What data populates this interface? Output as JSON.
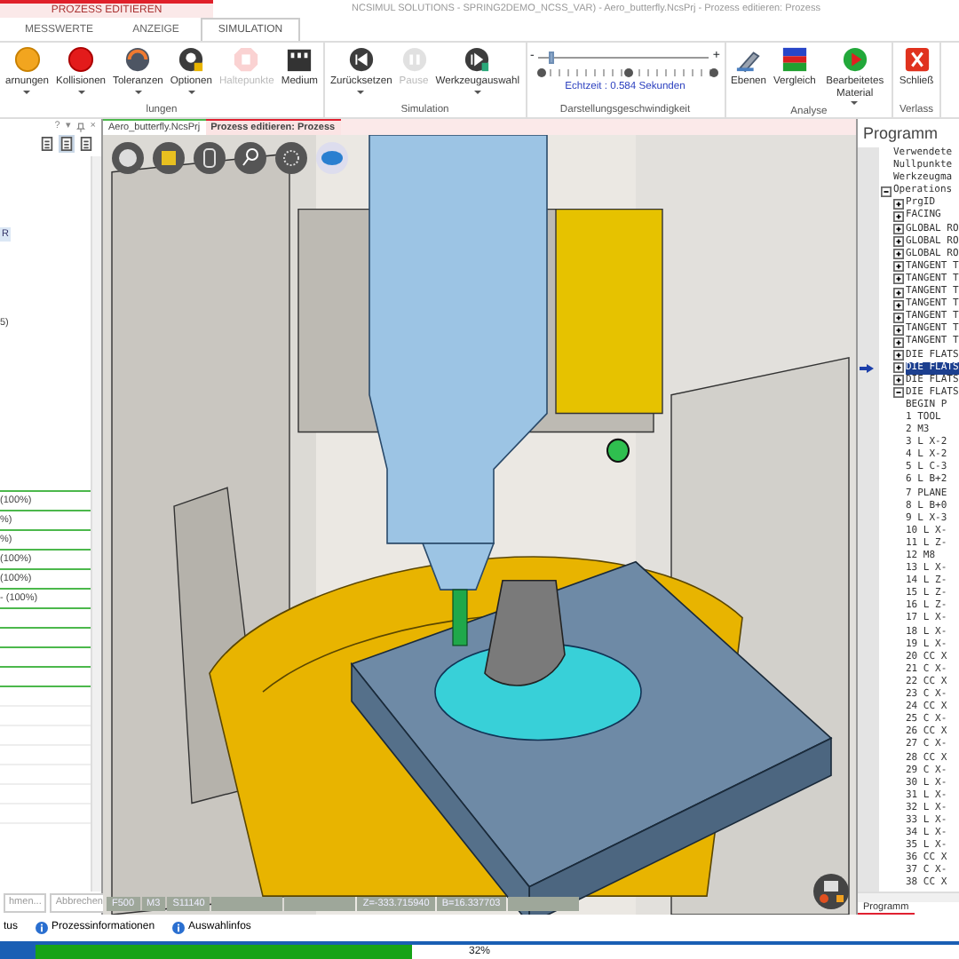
{
  "title_bar": {
    "context_tab": "PROZESS EDITIEREN",
    "title": "NCSIMUL SOLUTIONS - SPRING2DEMO_NCSS_VAR) - Aero_butterfly.NcsPrj - Prozess editieren: Prozess"
  },
  "ribbon_tabs": [
    {
      "label": "MESSWERTE",
      "selected": false
    },
    {
      "label": "ANZEIGE",
      "selected": false
    },
    {
      "label": "SIMULATION",
      "selected": true
    }
  ],
  "ribbon_groups": [
    {
      "label": "lungen",
      "kind": "buttons",
      "buttons": [
        {
          "label": "arnungen",
          "kind": "warning",
          "dropdown": true,
          "disabled": false
        },
        {
          "label": "Kollisionen",
          "kind": "collision",
          "dropdown": true,
          "disabled": false
        },
        {
          "label": "Toleranzen",
          "kind": "tolerance",
          "dropdown": true,
          "disabled": false
        },
        {
          "label": "Optionen",
          "kind": "options",
          "dropdown": true,
          "disabled": false
        },
        {
          "label": "Haltepunkte",
          "kind": "breakpoint",
          "dropdown": false,
          "disabled": true
        },
        {
          "label": "Medium",
          "kind": "medium",
          "dropdown": false,
          "disabled": false
        }
      ]
    },
    {
      "label": "Simulation",
      "kind": "buttons",
      "buttons": [
        {
          "label": "Zurücksetzen",
          "kind": "reset",
          "dropdown": true,
          "disabled": false
        },
        {
          "label": "Pause",
          "kind": "pause",
          "dropdown": false,
          "disabled": true
        },
        {
          "label": "Werkzeugauswahl",
          "kind": "tool",
          "dropdown": true,
          "disabled": false
        }
      ]
    },
    {
      "label": "Darstellungsgeschwindigkeit",
      "kind": "slider",
      "slider": {
        "minus": "-",
        "plus": "+",
        "level": 0.08,
        "reading": "Echtzeit : 0.584 Sekunden"
      }
    },
    {
      "label": "Analyse",
      "kind": "buttons",
      "buttons": [
        {
          "label": "Ebenen",
          "kind": "layers",
          "dropdown": false,
          "disabled": false
        },
        {
          "label": "Vergleich",
          "kind": "compare",
          "dropdown": false,
          "disabled": false
        },
        {
          "label": "Bearbeitetes Material",
          "kind": "material",
          "dropdown": true,
          "disabled": false
        }
      ]
    },
    {
      "label": "Verlass",
      "kind": "buttons",
      "buttons": [
        {
          "label": "Schließ",
          "kind": "close",
          "dropdown": false,
          "disabled": false
        }
      ]
    }
  ],
  "left_panel": {
    "header_symbols": [
      "?",
      "▾",
      "×"
    ],
    "view_buttons": [
      {
        "selected": false
      },
      {
        "selected": true
      },
      {
        "selected": false
      }
    ],
    "items": [
      {
        "text": "R",
        "kind": "tag"
      },
      {
        "text": "5)",
        "kind": "plain"
      }
    ],
    "rows": [
      {
        "kind": "green"
      },
      {
        "kind": "green",
        "text": "(100%)"
      },
      {
        "kind": "green",
        "text": "%)"
      },
      {
        "kind": "green",
        "text": "%)"
      },
      {
        "kind": "green",
        "text": "(100%)"
      },
      {
        "kind": "green",
        "text": "(100%)"
      },
      {
        "kind": "green",
        "text": "- (100%)"
      },
      {
        "kind": "green"
      },
      {
        "kind": "green"
      },
      {
        "kind": "green"
      },
      {
        "kind": "green"
      },
      {
        "kind": "gray"
      },
      {
        "kind": "gray"
      },
      {
        "kind": "gray"
      },
      {
        "kind": "gray"
      },
      {
        "kind": "gray"
      },
      {
        "kind": "gray"
      },
      {
        "kind": "gray"
      }
    ],
    "buttons": [
      "hmen...",
      "Abbrechen"
    ]
  },
  "doc_tabs": [
    {
      "label": "Aero_butterfly.NcsPrj",
      "selected": false
    },
    {
      "label": "Prozess editieren: Prozess",
      "selected": true
    }
  ],
  "viewport": {
    "status_fields": [
      {
        "kind": "text",
        "text": "F500"
      },
      {
        "kind": "text",
        "text": "M3"
      },
      {
        "kind": "text",
        "text": "S11140"
      },
      {
        "kind": "blank"
      },
      {
        "kind": "blank"
      },
      {
        "kind": "text",
        "text": "Z=-333.715940"
      },
      {
        "kind": "text",
        "text": "B=16.337703"
      },
      {
        "kind": "blank"
      }
    ]
  },
  "program_panel": {
    "title": "Programm",
    "tab": "Programm",
    "tree": [
      {
        "label": "Verwendete",
        "selected": false
      },
      {
        "label": "Nullpunkte",
        "selected": false
      },
      {
        "label": "Werkzeugma",
        "selected": false
      },
      {
        "label": "Operations",
        "selected": false,
        "expanded": true,
        "children": [
          {
            "label": "PrgID",
            "selected": false,
            "expanded": false
          },
          {
            "label": "FACING",
            "selected": false,
            "expanded": false
          },
          {
            "label": "GLOBAL RO",
            "selected": false,
            "expanded": false
          },
          {
            "label": "GLOBAL RO",
            "selected": false,
            "expanded": false
          },
          {
            "label": "GLOBAL RO",
            "selected": false,
            "expanded": false
          },
          {
            "label": "TANGENT T",
            "selected": false,
            "expanded": false
          },
          {
            "label": "TANGENT T",
            "selected": false,
            "expanded": false
          },
          {
            "label": "TANGENT T",
            "selected": false,
            "expanded": false
          },
          {
            "label": "TANGENT T",
            "selected": false,
            "expanded": false
          },
          {
            "label": "TANGENT T",
            "selected": false,
            "expanded": false
          },
          {
            "label": "TANGENT T",
            "selected": false,
            "expanded": false
          },
          {
            "label": "TANGENT T",
            "selected": false,
            "expanded": false
          },
          {
            "label": "DIE FLATS",
            "selected": false,
            "expanded": false
          },
          {
            "label": "DIE FLATS",
            "selected": true,
            "expanded": false
          },
          {
            "label": "DIE FLATS",
            "selected": false,
            "expanded": false
          },
          {
            "label": "DIE FLATS",
            "selected": false,
            "expanded": true,
            "children": [
              {
                "label": "BEGIN P",
                "selected": false
              },
              {
                "label": "1 TOOL",
                "selected": false
              },
              {
                "label": "2 M3",
                "selected": false
              },
              {
                "label": "3 L X-2",
                "selected": false
              },
              {
                "label": "4 L X-2",
                "selected": false
              },
              {
                "label": "5 L C-3",
                "selected": false
              },
              {
                "label": "6 L B+2",
                "selected": false
              },
              {
                "label": "7 PLANE",
                "selected": false
              },
              {
                "label": "8 L B+0",
                "selected": false
              },
              {
                "label": "9 L X-3",
                "selected": false
              },
              {
                "label": "10 L X-",
                "selected": false
              },
              {
                "label": "11 L Z-",
                "selected": false
              },
              {
                "label": "12 M8",
                "selected": false
              },
              {
                "label": "13 L X-",
                "selected": false
              },
              {
                "label": "14 L Z-",
                "selected": false
              },
              {
                "label": "15 L Z-",
                "selected": false
              },
              {
                "label": "16 L Z-",
                "selected": false
              },
              {
                "label": "17 L X-",
                "selected": false
              },
              {
                "label": "18 L X-",
                "selected": false
              },
              {
                "label": "19 L X-",
                "selected": false
              },
              {
                "label": "20 CC X",
                "selected": false
              },
              {
                "label": "21 C X-",
                "selected": false
              },
              {
                "label": "22 CC X",
                "selected": false
              },
              {
                "label": "23 C X-",
                "selected": false
              },
              {
                "label": "24 CC X",
                "selected": false
              },
              {
                "label": "25 C X-",
                "selected": false
              },
              {
                "label": "26 CC X",
                "selected": false
              },
              {
                "label": "27 C X-",
                "selected": false
              },
              {
                "label": "28 CC X",
                "selected": false
              },
              {
                "label": "29 C X-",
                "selected": false
              },
              {
                "label": "30 L X-",
                "selected": false
              },
              {
                "label": "31 L X-",
                "selected": false
              },
              {
                "label": "32 L X-",
                "selected": false
              },
              {
                "label": "33 L X-",
                "selected": false
              },
              {
                "label": "34 L X-",
                "selected": false
              },
              {
                "label": "35 L X-",
                "selected": false
              },
              {
                "label": "36 CC X",
                "selected": false
              },
              {
                "label": "37 C X-",
                "selected": false
              },
              {
                "label": "38 CC X",
                "selected": false
              }
            ]
          }
        ]
      }
    ]
  },
  "status_tabs": [
    {
      "label": "tus",
      "info_icon": false
    },
    {
      "label": "Prozessinformationen",
      "info_icon": true
    },
    {
      "label": "Auswahlinfos",
      "info_icon": true
    }
  ],
  "progress": {
    "level": 0.43,
    "reading": "32%"
  }
}
